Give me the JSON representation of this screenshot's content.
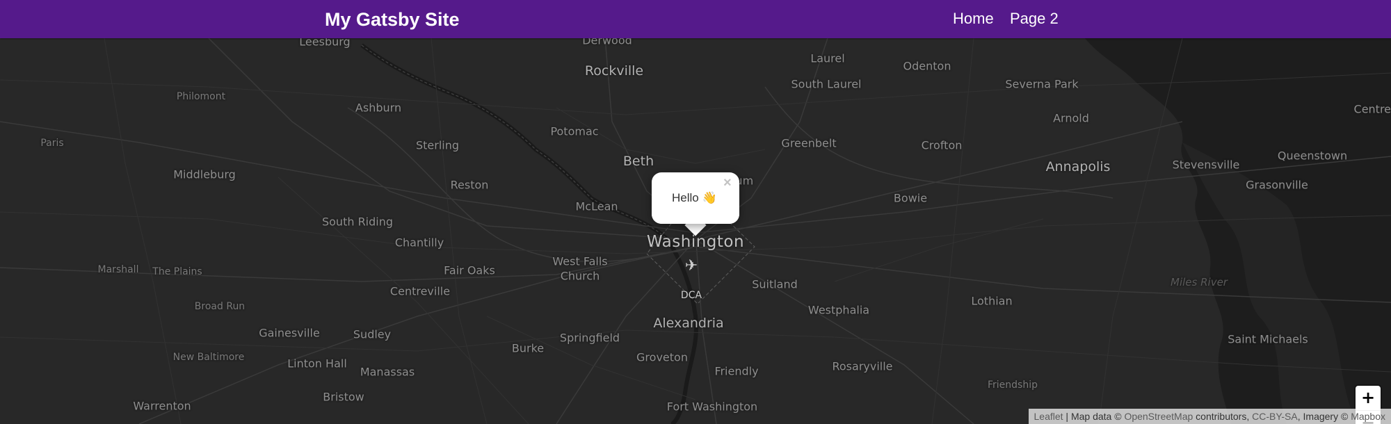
{
  "header": {
    "site_title": "My Gatsby Site",
    "nav": [
      {
        "label": "Home"
      },
      {
        "label": "Page 2"
      }
    ],
    "background_color": "#551a8b"
  },
  "map": {
    "places": [
      {
        "name": "Leesburg",
        "size": "normal"
      },
      {
        "name": "Derwood",
        "size": "normal"
      },
      {
        "name": "Rockville",
        "size": "med"
      },
      {
        "name": "Laurel",
        "size": "normal"
      },
      {
        "name": "Odenton",
        "size": "normal"
      },
      {
        "name": "Severna Park",
        "size": "normal"
      },
      {
        "name": "Philomont",
        "size": "small"
      },
      {
        "name": "South Laurel",
        "size": "normal"
      },
      {
        "name": "Centrev",
        "size": "normal"
      },
      {
        "name": "Ashburn",
        "size": "normal"
      },
      {
        "name": "Arnold",
        "size": "normal"
      },
      {
        "name": "Potomac",
        "size": "normal"
      },
      {
        "name": "Paris",
        "size": "small"
      },
      {
        "name": "Sterling",
        "size": "normal"
      },
      {
        "name": "Beth",
        "size": "med"
      },
      {
        "name": "Greenbelt",
        "size": "normal"
      },
      {
        "name": "Crofton",
        "size": "normal"
      },
      {
        "name": "Annapolis",
        "size": "med"
      },
      {
        "name": "Stevensville",
        "size": "normal"
      },
      {
        "name": "Queenstown",
        "size": "normal"
      },
      {
        "name": "Middleburg",
        "size": "normal"
      },
      {
        "name": "Reston",
        "size": "normal"
      },
      {
        "name": "Grasonville",
        "size": "normal"
      },
      {
        "name": "Bowie",
        "size": "normal"
      },
      {
        "name": "McLean",
        "size": "normal"
      },
      {
        "name": "South Riding",
        "size": "normal"
      },
      {
        "name": "Washington",
        "size": "big"
      },
      {
        "name": "Chantilly",
        "size": "normal"
      },
      {
        "name": "West Falls",
        "size": "normal"
      },
      {
        "name": "Church",
        "size": "normal"
      },
      {
        "name": "Fair Oaks",
        "size": "normal"
      },
      {
        "name": "Marshall",
        "size": "small"
      },
      {
        "name": "The Plains",
        "size": "small"
      },
      {
        "name": "Suitland",
        "size": "normal"
      },
      {
        "name": "Miles River",
        "size": "water"
      },
      {
        "name": "Centreville",
        "size": "normal"
      },
      {
        "name": "Lothian",
        "size": "normal"
      },
      {
        "name": "Broad Run",
        "size": "small"
      },
      {
        "name": "Westphalia",
        "size": "normal"
      },
      {
        "name": "Alexandria",
        "size": "med"
      },
      {
        "name": "Gainesville",
        "size": "normal"
      },
      {
        "name": "Sudley",
        "size": "normal"
      },
      {
        "name": "Springfield",
        "size": "normal"
      },
      {
        "name": "Saint Michaels",
        "size": "normal"
      },
      {
        "name": "Burke",
        "size": "normal"
      },
      {
        "name": "New Baltimore",
        "size": "small"
      },
      {
        "name": "Groveton",
        "size": "normal"
      },
      {
        "name": "Linton Hall",
        "size": "normal"
      },
      {
        "name": "Rosaryville",
        "size": "normal"
      },
      {
        "name": "Manassas",
        "size": "normal"
      },
      {
        "name": "Friendly",
        "size": "normal"
      },
      {
        "name": "Friendship",
        "size": "small"
      },
      {
        "name": "Bristow",
        "size": "normal"
      },
      {
        "name": "Warrenton",
        "size": "normal"
      },
      {
        "name": "Fort Washington",
        "size": "normal"
      },
      {
        "name": "rum",
        "size": "normal"
      },
      {
        "name": "DCA",
        "size": "small"
      }
    ],
    "airport_icon": "airplane-icon",
    "marker": {
      "icon": "map-pin-icon",
      "color": "#6f4fa0"
    },
    "popup": {
      "text": "Hello 👋",
      "close_label": "×"
    },
    "zoom": {
      "in_label": "+",
      "out_label": "−"
    },
    "attribution": {
      "leaflet": "Leaflet",
      "sep1": " | Map data © ",
      "osm": "OpenStreetMap",
      "sep2": " contributors, ",
      "license": "CC-BY-SA",
      "sep3": ", Imagery © ",
      "mapbox": "Mapbox"
    }
  }
}
